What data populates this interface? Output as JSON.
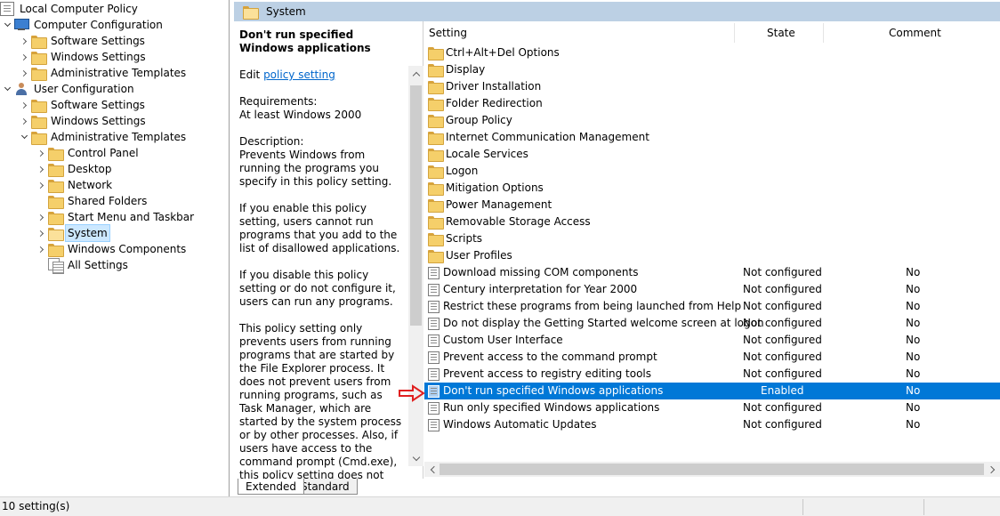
{
  "tree": {
    "nodes": [
      {
        "label": "Local Computer Policy",
        "icon": "policy-icon",
        "expander": "none",
        "depth": 0
      },
      {
        "label": "Computer Configuration",
        "icon": "computer-icon",
        "expander": "expanded",
        "depth": 0
      },
      {
        "label": "Software Settings",
        "icon": "folder-icon",
        "expander": "collapsed",
        "depth": 1
      },
      {
        "label": "Windows Settings",
        "icon": "folder-icon",
        "expander": "collapsed",
        "depth": 1
      },
      {
        "label": "Administrative Templates",
        "icon": "folder-icon",
        "expander": "collapsed",
        "depth": 1
      },
      {
        "label": "User Configuration",
        "icon": "user-icon",
        "expander": "expanded",
        "depth": 0
      },
      {
        "label": "Software Settings",
        "icon": "folder-icon",
        "expander": "collapsed",
        "depth": 1
      },
      {
        "label": "Windows Settings",
        "icon": "folder-icon",
        "expander": "collapsed",
        "depth": 1
      },
      {
        "label": "Administrative Templates",
        "icon": "folder-icon",
        "expander": "expanded",
        "depth": 1
      },
      {
        "label": "Control Panel",
        "icon": "folder-icon",
        "expander": "collapsed",
        "depth": 2
      },
      {
        "label": "Desktop",
        "icon": "folder-icon",
        "expander": "collapsed",
        "depth": 2
      },
      {
        "label": "Network",
        "icon": "folder-icon",
        "expander": "collapsed",
        "depth": 2
      },
      {
        "label": "Shared Folders",
        "icon": "folder-icon",
        "expander": "none",
        "depth": 2
      },
      {
        "label": "Start Menu and Taskbar",
        "icon": "folder-icon",
        "expander": "collapsed",
        "depth": 2
      },
      {
        "label": "System",
        "icon": "folder-icon",
        "expander": "collapsed",
        "depth": 2,
        "selected": true
      },
      {
        "label": "Windows Components",
        "icon": "folder-icon",
        "expander": "collapsed",
        "depth": 2
      },
      {
        "label": "All Settings",
        "icon": "all-settings-icon",
        "expander": "none",
        "depth": 2
      }
    ]
  },
  "header": {
    "title": "System"
  },
  "description": {
    "title": "Don't run specified Windows applications",
    "edit_prefix": "Edit ",
    "edit_link": "policy setting ",
    "requirements_label": "Requirements:",
    "requirements_value": "At least Windows 2000",
    "description_label": "Description:",
    "paragraph_1": "Prevents Windows from running the programs you specify in this policy setting.",
    "paragraph_2": "If you enable this policy setting, users cannot run programs that you add to the list of disallowed applications.",
    "paragraph_3": "If you disable this policy setting or do not configure it, users can run any programs.",
    "paragraph_4": "This policy setting only prevents users from running programs that are started by the File Explorer process. It does not prevent users from running programs, such as Task Manager, which are started by the system process or by other processes.  Also, if users have access to the command prompt (Cmd.exe), this policy setting does not prevent them from starting programs in the command"
  },
  "list": {
    "columns": {
      "setting": "Setting",
      "state": "State",
      "comment": "Comment"
    },
    "rows": [
      {
        "type": "folder",
        "name": "Ctrl+Alt+Del Options",
        "state": "",
        "comment": ""
      },
      {
        "type": "folder",
        "name": "Display",
        "state": "",
        "comment": ""
      },
      {
        "type": "folder",
        "name": "Driver Installation",
        "state": "",
        "comment": ""
      },
      {
        "type": "folder",
        "name": "Folder Redirection",
        "state": "",
        "comment": ""
      },
      {
        "type": "folder",
        "name": "Group Policy",
        "state": "",
        "comment": ""
      },
      {
        "type": "folder",
        "name": "Internet Communication Management",
        "state": "",
        "comment": ""
      },
      {
        "type": "folder",
        "name": "Locale Services",
        "state": "",
        "comment": ""
      },
      {
        "type": "folder",
        "name": "Logon",
        "state": "",
        "comment": ""
      },
      {
        "type": "folder",
        "name": "Mitigation Options",
        "state": "",
        "comment": ""
      },
      {
        "type": "folder",
        "name": "Power Management",
        "state": "",
        "comment": ""
      },
      {
        "type": "folder",
        "name": "Removable Storage Access",
        "state": "",
        "comment": ""
      },
      {
        "type": "folder",
        "name": "Scripts",
        "state": "",
        "comment": ""
      },
      {
        "type": "folder",
        "name": "User Profiles",
        "state": "",
        "comment": ""
      },
      {
        "type": "policy",
        "name": "Download missing COM components",
        "state": "Not configured",
        "comment": "No"
      },
      {
        "type": "policy",
        "name": "Century interpretation for Year 2000",
        "state": "Not configured",
        "comment": "No"
      },
      {
        "type": "policy",
        "name": "Restrict these programs from being launched from Help",
        "state": "Not configured",
        "comment": "No"
      },
      {
        "type": "policy",
        "name": "Do not display the Getting Started welcome screen at logon",
        "state": "Not configured",
        "comment": "No"
      },
      {
        "type": "policy",
        "name": "Custom User Interface",
        "state": "Not configured",
        "comment": "No"
      },
      {
        "type": "policy",
        "name": "Prevent access to the command prompt",
        "state": "Not configured",
        "comment": "No"
      },
      {
        "type": "policy",
        "name": "Prevent access to registry editing tools",
        "state": "Not configured",
        "comment": "No"
      },
      {
        "type": "policy",
        "name": "Don't run specified Windows applications",
        "state": "Enabled",
        "comment": "No",
        "selected": true
      },
      {
        "type": "policy",
        "name": "Run only specified Windows applications",
        "state": "Not configured",
        "comment": "No"
      },
      {
        "type": "policy",
        "name": "Windows Automatic Updates",
        "state": "Not configured",
        "comment": "No"
      }
    ]
  },
  "tabs": [
    {
      "label": "Extended",
      "active": true
    },
    {
      "label": "Standard",
      "active": false
    }
  ],
  "status_bar": {
    "text": "10 setting(s)"
  },
  "colors": {
    "selection": "#0078d7",
    "tree_selection": "#cce8ff",
    "header_bar": "#bcd0e4",
    "callout_arrow": "#e02020",
    "link": "#0066cc"
  }
}
